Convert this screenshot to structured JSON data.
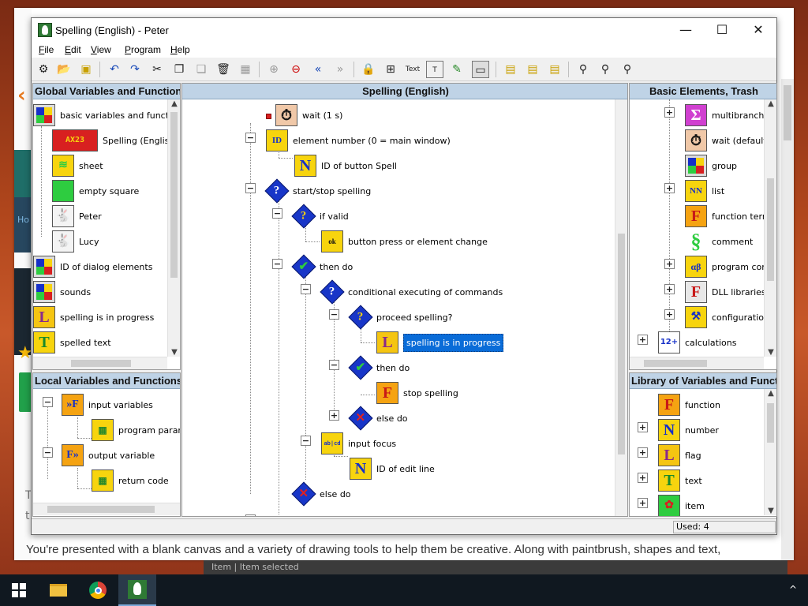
{
  "window": {
    "title": "Spelling (English) - Peter",
    "min": "—",
    "max": "☐",
    "close": "✕"
  },
  "menu": [
    {
      "key": "F",
      "rest": "ile"
    },
    {
      "key": "E",
      "rest": "dit"
    },
    {
      "key": "V",
      "rest": "iew"
    },
    {
      "key": "P",
      "rest": "rogram"
    },
    {
      "key": "H",
      "rest": "elp"
    }
  ],
  "toolbar": {
    "text_label": "Text"
  },
  "panels": {
    "global": {
      "title": "Global Variables and Functions",
      "items": [
        {
          "label": "basic variables and functions",
          "icon": "quad-icon"
        },
        {
          "label": "Spelling (English)",
          "icon": "ax23-icon",
          "icon_text": "AX23"
        },
        {
          "label": "sheet",
          "icon": "sheet-icon"
        },
        {
          "label": "empty square",
          "icon": "square-icon"
        },
        {
          "label": "Peter",
          "icon": "bunny-icon"
        },
        {
          "label": "Lucy",
          "icon": "bunny-icon"
        },
        {
          "label": "ID of dialog elements",
          "icon": "quad-icon"
        },
        {
          "label": "sounds",
          "icon": "quad-icon"
        },
        {
          "label": "spelling is in progress",
          "icon": "flag-icon",
          "icon_text": "L"
        },
        {
          "label": "spelled text",
          "icon": "text-icon",
          "icon_text": "T"
        }
      ]
    },
    "local": {
      "title": "Local Variables and Functions",
      "items": [
        {
          "label": "input variables",
          "icon": "input-vars-icon",
          "icon_text": "F"
        },
        {
          "label": "program parameters",
          "icon": "program-param-icon"
        },
        {
          "label": "output variable",
          "icon": "output-var-icon",
          "icon_text": "F"
        },
        {
          "label": "return code",
          "icon": "return-code-icon"
        }
      ]
    },
    "center": {
      "title": "Spelling (English)",
      "items": [
        {
          "label": "wait (1 s)",
          "icon": "stopwatch-icon"
        },
        {
          "label": "element number (0 = main window)",
          "icon": "id-icon",
          "icon_text": "ID"
        },
        {
          "label": "ID of button Spell",
          "icon": "number-icon",
          "icon_text": "N"
        },
        {
          "label": "start/stop spelling",
          "icon": "condition-icon",
          "icon_text": "?"
        },
        {
          "label": "if valid",
          "icon": "if-icon",
          "icon_text": "?"
        },
        {
          "label": "button press or element change",
          "icon": "button-press-icon",
          "icon_text": "ok"
        },
        {
          "label": "then do",
          "icon": "check-icon",
          "icon_text": "✔"
        },
        {
          "label": "conditional executing of commands",
          "icon": "condition-icon",
          "icon_text": "?"
        },
        {
          "label": "proceed spelling?",
          "icon": "if-icon",
          "icon_text": "?"
        },
        {
          "label": "spelling is in progress",
          "icon": "flag-icon",
          "icon_text": "L"
        },
        {
          "label": "then do",
          "icon": "check-icon",
          "icon_text": "✔"
        },
        {
          "label": "stop spelling",
          "icon": "function-icon",
          "icon_text": "F"
        },
        {
          "label": "else do",
          "icon": "cross-icon",
          "icon_text": "✕"
        },
        {
          "label": "input focus",
          "icon": "input-focus-icon",
          "icon_text": "ab|cd"
        },
        {
          "label": "ID of edit line",
          "icon": "number-icon",
          "icon_text": "N"
        },
        {
          "label": "else do",
          "icon": "cross-icon",
          "icon_text": "✕"
        }
      ]
    },
    "basic": {
      "title": "Basic Elements, Trash",
      "items": [
        {
          "label": "multibranch conditional",
          "icon": "multibranch-icon",
          "icon_text": "Σ"
        },
        {
          "label": "wait (default)",
          "icon": "stopwatch-icon"
        },
        {
          "label": "group",
          "icon": "quad-icon"
        },
        {
          "label": "list",
          "icon": "list-icon",
          "icon_text": "NN"
        },
        {
          "label": "function termination",
          "icon": "function-term-icon",
          "icon_text": "F"
        },
        {
          "label": "comment",
          "icon": "comment-icon"
        },
        {
          "label": "program control",
          "icon": "program-control-icon",
          "icon_text": "α"
        },
        {
          "label": "DLL libraries",
          "icon": "dll-icon",
          "icon_text": "F"
        },
        {
          "label": "configuration",
          "icon": "configuration-icon"
        },
        {
          "label": "calculations",
          "icon": "calculations-icon",
          "icon_text": "12+"
        }
      ]
    },
    "library": {
      "title": "Library of Variables and Functions",
      "items": [
        {
          "label": "function",
          "icon": "function-icon",
          "icon_text": "F"
        },
        {
          "label": "number",
          "icon": "number-icon",
          "icon_text": "N"
        },
        {
          "label": "flag",
          "icon": "flag-icon",
          "icon_text": "L"
        },
        {
          "label": "text",
          "icon": "text-icon",
          "icon_text": "T"
        },
        {
          "label": "item",
          "icon": "item-icon"
        }
      ]
    }
  },
  "status": {
    "used": "Used: 4"
  },
  "background": {
    "article_text": "You're presented with a blank canvas and a variety of drawing tools to help them be creative. Along with paintbrush, shapes and text,",
    "bottom_bar": "Item  |  Item selected",
    "left_link": "Ho",
    "left_t1": "T",
    "left_t2": "t"
  },
  "colors": {
    "header_bg": "#bfd3e6",
    "selection": "#0a6cd8",
    "flag_yellow": "#f7d40e",
    "function_orange": "#f5a312",
    "diamond_blue": "#1836c8"
  }
}
